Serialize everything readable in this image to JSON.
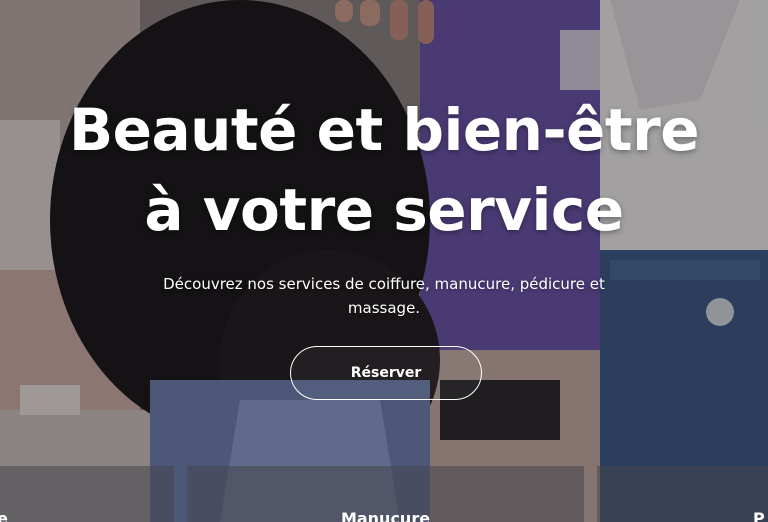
{
  "hero": {
    "title_line1": "Beauté et bien-être",
    "title_line2": "à votre service",
    "subtitle": "Découvrez nos services de coiffure, manucure, pédicure et massage.",
    "cta_label": "Réserver"
  },
  "services": {
    "left_label": "e",
    "center_label": "Manucure",
    "right_label": "P"
  }
}
